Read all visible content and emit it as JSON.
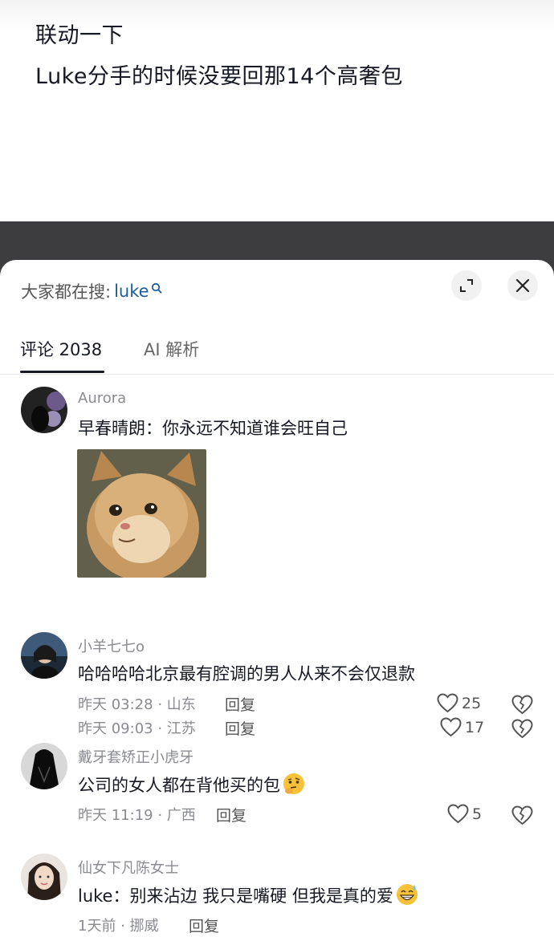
{
  "post": {
    "line1": "联动一下",
    "line2": "Luke分手的时候没要回那14个高奢包"
  },
  "search": {
    "prefix": "大家都在搜:",
    "term": "luke"
  },
  "tabs": {
    "comments": "评论 2038",
    "ai": "AI 解析"
  },
  "comments": [
    {
      "name": "Aurora",
      "text": "早春晴朗：你永远不知道谁会旺自己",
      "meta": "昨天 09:03 · 江苏",
      "reply": "回复",
      "likes": "17",
      "has_image": true
    },
    {
      "name": "小羊七七o",
      "text": "哈哈哈哈北京最有腔调的男人从来不会仅退款",
      "meta": "昨天 03:28 · 山东",
      "reply": "回复",
      "likes": "25"
    },
    {
      "name": "戴牙套矫正小虎牙",
      "text": "公司的女人都在背他买的包",
      "emoji": "thinking-face-emoji",
      "meta": "昨天 11:19 · 广西",
      "reply": "回复",
      "likes": "5"
    },
    {
      "name": "仙女下凡陈女士",
      "text": "luke：别来沾边 我只是嘴硬 但我是真的爱",
      "emoji": "grinning-sweat-emoji",
      "meta": "1天前 · 挪威",
      "reply": "回复"
    }
  ],
  "icons": {
    "expand": "expand-icon",
    "close": "close-icon",
    "like": "heart-icon",
    "dislike": "broken-heart-icon",
    "search": "search-icon"
  },
  "colors": {
    "search_term": "#1f5c9e",
    "muted_text": "#8a8b91",
    "video_band": "#3d3d3f"
  }
}
